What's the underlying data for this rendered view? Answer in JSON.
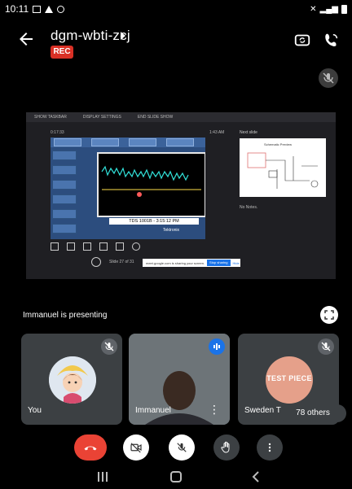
{
  "status": {
    "time": "10:11"
  },
  "header": {
    "title": "dgm-wbti-zcj",
    "rec": "REC"
  },
  "presentation": {
    "presenter_label": "Immanuel is presenting",
    "screen": {
      "toolbar": [
        "SHOW TASKBAR",
        "DISPLAY SETTINGS",
        "END SLIDE SHOW"
      ],
      "elapsed": "0:17:33",
      "clock": "1:43 AM",
      "next_slide_label": "Next slide",
      "next_slide_title": "Schematic Preview",
      "scope_caption": "TDS 1001B - 3:15:12 PM",
      "brand": "Tektronix",
      "slide_counter": "Slide 27 of 31",
      "share_text": "meet.google.com is sharing your screen.",
      "share_stop": "Stop sharing",
      "share_hide": "Hide",
      "notes": "No Notes."
    }
  },
  "tiles": [
    {
      "name": "You"
    },
    {
      "name": "Immanuel"
    },
    {
      "name": "Sweden Te",
      "logo_text": "TEST PIECE"
    }
  ],
  "others": "78 others",
  "colors": {
    "rec": "#d93025",
    "end_call": "#ea4335",
    "speaking": "#1a73e8",
    "tile": "#3c4043"
  }
}
